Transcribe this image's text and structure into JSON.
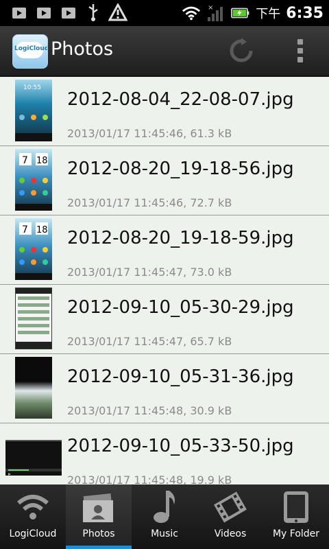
{
  "status_bar": {
    "ime_indicator": "下午",
    "time": "6:35",
    "icons": [
      "play-store-icon",
      "play-store-icon",
      "play-store-icon",
      "usb-icon",
      "warning-icon",
      "wifi-icon",
      "signal-icon",
      "battery-charging-icon"
    ]
  },
  "action_bar": {
    "app_logo_text": "LogiCloud",
    "title": "Photos",
    "icons": [
      "refresh-icon",
      "overflow-menu-icon"
    ]
  },
  "files": [
    {
      "name": "2012-08-04_22-08-07.jpg",
      "meta": "2013/01/17 11:45:46, 61.3 kB",
      "thumb": "home"
    },
    {
      "name": "2012-08-20_19-18-56.jpg",
      "meta": "2013/01/17 11:45:46, 72.7 kB",
      "thumb": "home2"
    },
    {
      "name": "2012-08-20_19-18-59.jpg",
      "meta": "2013/01/17 11:45:47, 73.0 kB",
      "thumb": "home2"
    },
    {
      "name": "2012-09-10_05-30-29.jpg",
      "meta": "2013/01/17 11:45:47, 65.7 kB",
      "thumb": "listshot"
    },
    {
      "name": "2012-09-10_05-31-36.jpg",
      "meta": "2013/01/17 11:45:48, 30.9 kB",
      "thumb": "photo"
    },
    {
      "name": "2012-09-10_05-33-50.jpg",
      "meta": "2013/01/17 11:45:48, 19.9 kB",
      "thumb": "player"
    }
  ],
  "tabs": [
    {
      "label": "LogiCloud",
      "icon": "wifi-icon",
      "active": false
    },
    {
      "label": "Photos",
      "icon": "photos-icon",
      "active": true
    },
    {
      "label": "Music",
      "icon": "music-note-icon",
      "active": false
    },
    {
      "label": "Videos",
      "icon": "film-icon",
      "active": false
    },
    {
      "label": "My Folder",
      "icon": "tablet-icon",
      "active": false
    }
  ],
  "colors": {
    "accent": "#1a8fd6",
    "list_bg": "#eef2ec"
  }
}
